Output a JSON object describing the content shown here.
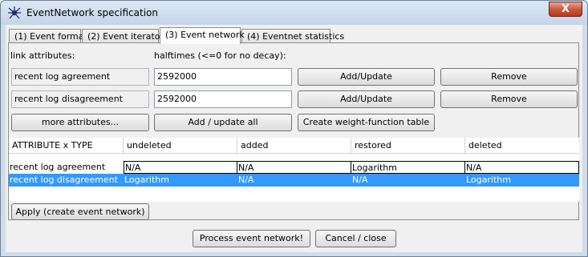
{
  "window": {
    "title": "EventNetwork specification",
    "close_glyph": "X",
    "app_icon": "spider-icon"
  },
  "tabs": [
    {
      "label": "(1) Event format",
      "active": false
    },
    {
      "label": "(2) Event iterator",
      "active": false
    },
    {
      "label": "(3) Event network",
      "active": true
    },
    {
      "label": "(4) Eventnet statistics",
      "active": false
    }
  ],
  "panel": {
    "link_attributes_label": "link attributes:",
    "halftimes_label": "halftimes (<=0 for no decay):",
    "attributes": [
      {
        "name": "recent log agreement",
        "halftime": "2592000",
        "add_label": "Add/Update",
        "remove_label": "Remove"
      },
      {
        "name": "recent log disagreement",
        "halftime": "2592000",
        "add_label": "Add/Update",
        "remove_label": "Remove"
      }
    ],
    "more_attributes_label": "more attributes...",
    "add_update_all_label": "Add / update all",
    "weight_table_label": "Create weight-function table"
  },
  "table": {
    "columns": [
      "ATTRIBUTE x TYPE",
      "undeleted",
      "added",
      "restored",
      "deleted"
    ],
    "rows": [
      {
        "cells": [
          "recent log agreement",
          "N/A",
          "N/A",
          "Logarithm",
          "N/A"
        ],
        "selected": false
      },
      {
        "cells": [
          "recent log disagreement",
          "Logarithm",
          "N/A",
          "N/A",
          "Logarithm"
        ],
        "selected": true
      }
    ]
  },
  "apply_label": "Apply (create event network)",
  "footer": {
    "process_label": "Process event network!",
    "cancel_label": "Cancel / close"
  },
  "colors": {
    "selection": "#3399ff",
    "title_bar": "#cfdceb",
    "close_button": "#c75b40"
  }
}
